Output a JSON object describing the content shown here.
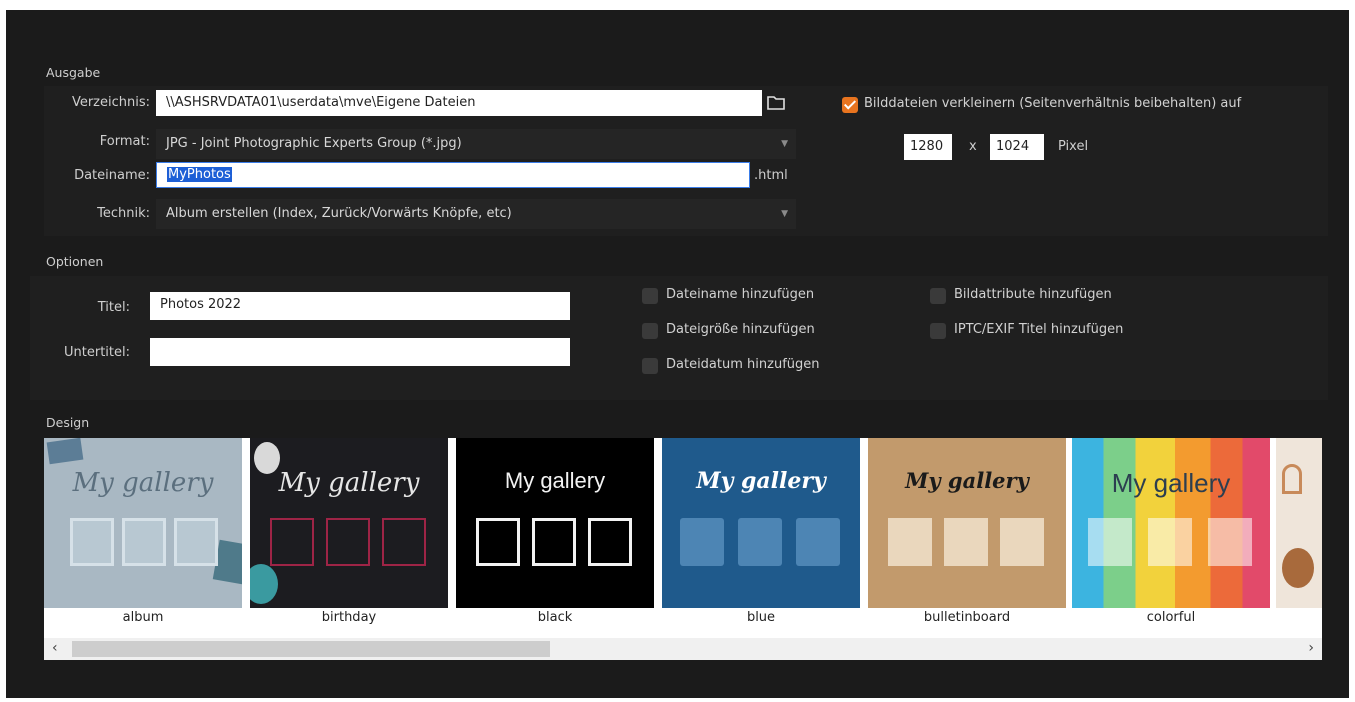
{
  "sections": {
    "output": "Ausgabe",
    "options": "Optionen",
    "design": "Design"
  },
  "output": {
    "directory_label": "Verzeichnis:",
    "directory_value": "\\\\ASHSRVDATA01\\userdata\\mve\\Eigene Dateien",
    "format_label": "Format:",
    "format_value": "JPG - Joint Photographic Experts Group (*.jpg)",
    "filename_label": "Dateiname:",
    "filename_value": "MyPhotos",
    "filename_ext": ".html",
    "technique_label": "Technik:",
    "technique_value": "Album erstellen (Index, Zurück/Vorwärts Knöpfe, etc)"
  },
  "resize": {
    "checked": true,
    "label": "Bilddateien verkleinern (Seitenverhältnis beibehalten) auf",
    "width": "1280",
    "separator": "x",
    "height": "1024",
    "unit": "Pixel"
  },
  "options": {
    "title_label": "Titel:",
    "title_value": "Photos 2022",
    "subtitle_label": "Untertitel:",
    "subtitle_value": "",
    "checks": [
      {
        "label": "Dateiname hinzufügen",
        "checked": false
      },
      {
        "label": "Dateigröße hinzufügen",
        "checked": false
      },
      {
        "label": "Dateidatum hinzufügen",
        "checked": false
      },
      {
        "label": "Bildattribute hinzufügen",
        "checked": false
      },
      {
        "label": "IPTC/EXIF Titel hinzufügen",
        "checked": false
      }
    ]
  },
  "design": {
    "themes": [
      {
        "name": "album",
        "title": "My gallery"
      },
      {
        "name": "birthday",
        "title": "My gallery"
      },
      {
        "name": "black",
        "title": "My gallery"
      },
      {
        "name": "blue",
        "title": "My gallery"
      },
      {
        "name": "bulletinboard",
        "title": "My gallery"
      },
      {
        "name": "colorful",
        "title": "My gallery"
      }
    ],
    "scroll_left": "‹",
    "scroll_right": "›"
  },
  "colors": {
    "accent": "#e8741f",
    "background": "#1b1b1b",
    "selection": "#1d5fd6"
  }
}
